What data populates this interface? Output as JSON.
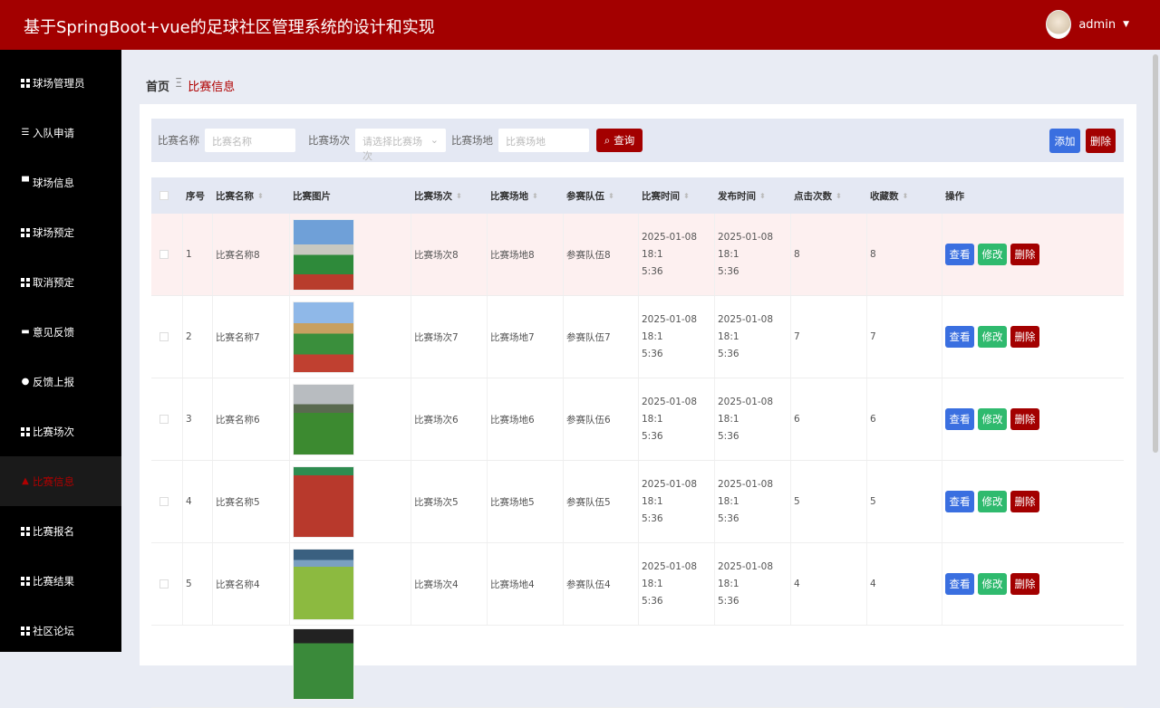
{
  "header": {
    "title": "基于SpringBoot+vue的足球社区管理系统的设计和实现",
    "user": "admin"
  },
  "sidebar": [
    {
      "label": "球场管理员",
      "icon": "grid-icon"
    },
    {
      "label": "入队申请",
      "icon": "list-icon"
    },
    {
      "label": "球场信息",
      "icon": "briefcase-icon"
    },
    {
      "label": "球场预定",
      "icon": "grid-icon"
    },
    {
      "label": "取消预定",
      "icon": "grid-icon"
    },
    {
      "label": "意见反馈",
      "icon": "ticket-icon"
    },
    {
      "label": "反馈上报",
      "icon": "bulb-icon"
    },
    {
      "label": "比赛场次",
      "icon": "grid-icon"
    },
    {
      "label": "比赛信息",
      "icon": "user-icon",
      "active": true
    },
    {
      "label": "比赛报名",
      "icon": "grid-icon"
    },
    {
      "label": "比赛结果",
      "icon": "grid-icon"
    },
    {
      "label": "社区论坛",
      "icon": "grid-icon"
    }
  ],
  "breadcrumb": {
    "home": "首页",
    "sep": "Ξ",
    "current": "比赛信息"
  },
  "search": {
    "name_label": "比赛名称",
    "name_placeholder": "比赛名称",
    "round_label": "比赛场次",
    "round_placeholder": "请选择比赛场次",
    "venue_label": "比赛场地",
    "venue_placeholder": "比赛场地",
    "query": "查询",
    "add": "添加",
    "delete": "删除"
  },
  "table": {
    "headers": [
      "序号",
      "比赛名称",
      "比赛图片",
      "比赛场次",
      "比赛场地",
      "参赛队伍",
      "比赛时间",
      "发布时间",
      "点击次数",
      "收藏数",
      "操作"
    ],
    "actions": {
      "view": "查看",
      "edit": "修改",
      "delete": "删除"
    },
    "rows": [
      {
        "no": "1",
        "name": "比赛名称8",
        "round": "比赛场次8",
        "venue": "比赛场地8",
        "team": "参赛队伍8",
        "time1": "2025-01-08 18:1",
        "time2": "5:36",
        "pub1": "2025-01-08 18:1",
        "pub2": "5:36",
        "clicks": "8",
        "favs": "8"
      },
      {
        "no": "2",
        "name": "比赛名称7",
        "round": "比赛场次7",
        "venue": "比赛场地7",
        "team": "参赛队伍7",
        "time1": "2025-01-08 18:1",
        "time2": "5:36",
        "pub1": "2025-01-08 18:1",
        "pub2": "5:36",
        "clicks": "7",
        "favs": "7"
      },
      {
        "no": "3",
        "name": "比赛名称6",
        "round": "比赛场次6",
        "venue": "比赛场地6",
        "team": "参赛队伍6",
        "time1": "2025-01-08 18:1",
        "time2": "5:36",
        "pub1": "2025-01-08 18:1",
        "pub2": "5:36",
        "clicks": "6",
        "favs": "6"
      },
      {
        "no": "4",
        "name": "比赛名称5",
        "round": "比赛场次5",
        "venue": "比赛场地5",
        "team": "参赛队伍5",
        "time1": "2025-01-08 18:1",
        "time2": "5:36",
        "pub1": "2025-01-08 18:1",
        "pub2": "5:36",
        "clicks": "5",
        "favs": "5"
      },
      {
        "no": "5",
        "name": "比赛名称4",
        "round": "比赛场次4",
        "venue": "比赛场地4",
        "team": "参赛队伍4",
        "time1": "2025-01-08 18:1",
        "time2": "5:36",
        "pub1": "2025-01-08 18:1",
        "pub2": "5:36",
        "clicks": "4",
        "favs": "4"
      }
    ]
  }
}
